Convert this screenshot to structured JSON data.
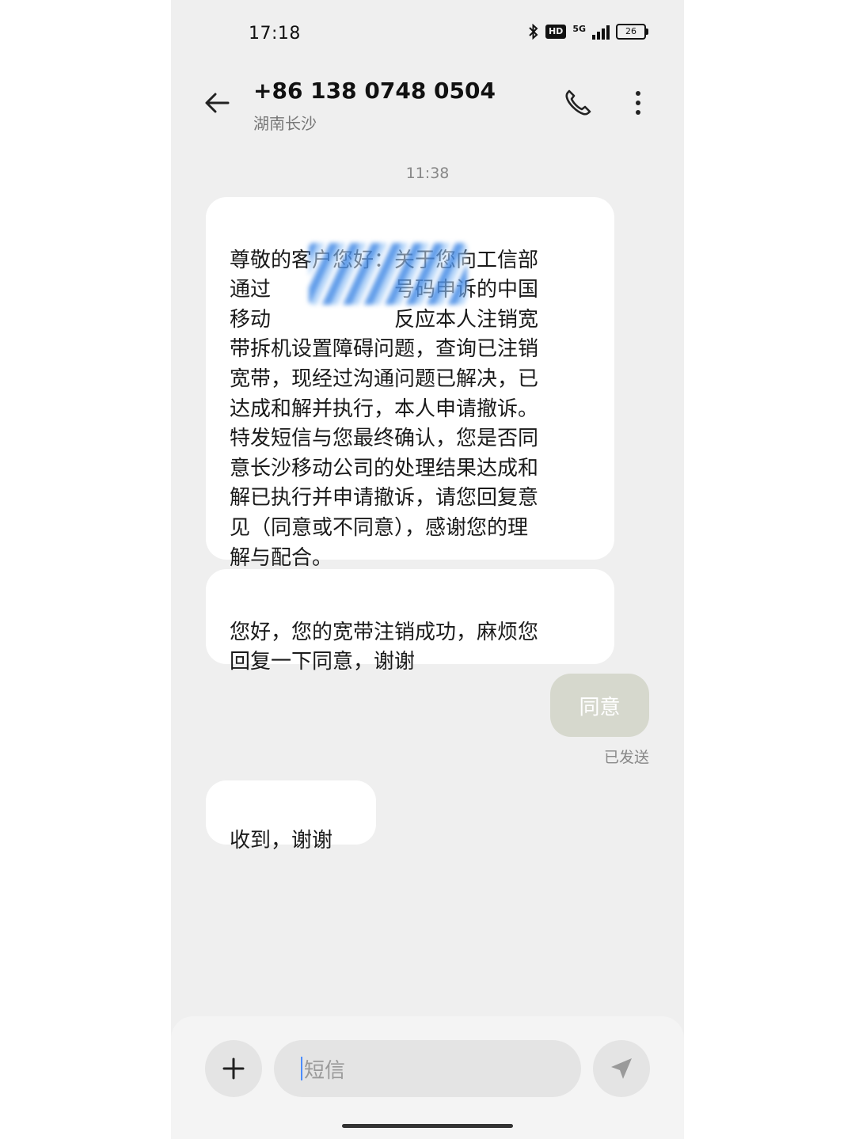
{
  "status_bar": {
    "time": "17:18",
    "bluetooth_icon": "bluetooth-icon",
    "hd_label": "HD",
    "network_label": "5G",
    "battery_level": "26"
  },
  "header": {
    "contact_number": "+86 138 0748 0504",
    "contact_location": "湖南长沙"
  },
  "conversation": {
    "timestamp": "11:38",
    "messages": [
      {
        "direction": "incoming",
        "text": "尊敬的客户您好：关于您向工信部\n通过　　　　　　号码申诉的中国\n移动　　　　　　反应本人注销宽\n带拆机设置障碍问题，查询已注销\n宽带，现经过沟通问题已解决，已\n达成和解并执行，本人申请撤诉。\n特发短信与您最终确认，您是否同\n意长沙移动公司的处理结果达成和\n解已执行并申请撤诉，请您回复意\n见（同意或不同意），感谢您的理\n解与配合。"
      },
      {
        "direction": "incoming",
        "text": "您好，您的宽带注销成功，麻烦您\n回复一下同意，谢谢"
      },
      {
        "direction": "outgoing",
        "text": "同意",
        "status": "已发送"
      },
      {
        "direction": "incoming",
        "text": "收到，谢谢"
      }
    ]
  },
  "composer": {
    "placeholder": "短信"
  },
  "colors": {
    "background": "#efefef",
    "incoming_bubble": "#ffffff",
    "outgoing_bubble": "#d6d8cd",
    "caret": "#4a8cff"
  }
}
